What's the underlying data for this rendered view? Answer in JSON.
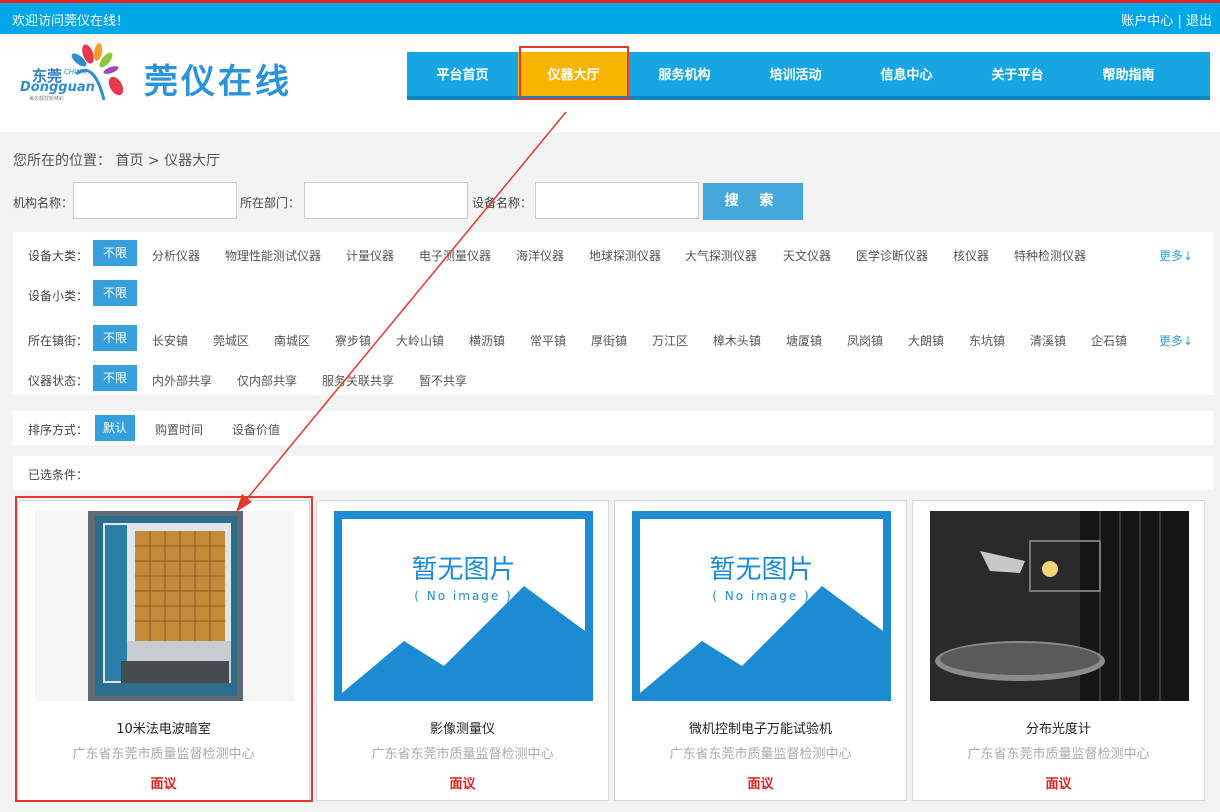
{
  "topbar": {
    "welcome": "欢迎访问莞仪在线！",
    "account": "账户中心",
    "separator": "|",
    "logout": "退出"
  },
  "logo": {
    "city_cn": "东莞",
    "city_en": "Dongguan",
    "china": "CHINA",
    "slogan": "每天都放新精彩",
    "site_name": "莞仪在线"
  },
  "nav": {
    "items": [
      "平台首页",
      "仪器大厅",
      "服务机构",
      "培训活动",
      "信息中心",
      "关于平台",
      "帮助指南"
    ],
    "active_index": 1
  },
  "breadcrumb": {
    "prefix": "您所在的位置：",
    "home": "首页",
    "sep": ">",
    "current": "仪器大厅"
  },
  "search": {
    "org_label": "机构名称：",
    "dept_label": "所在部门：",
    "device_label": "设备名称：",
    "org_value": "",
    "dept_value": "",
    "device_value": "",
    "button": "搜 索"
  },
  "filters": {
    "category": {
      "label": "设备大类：",
      "selected": "不限",
      "options": [
        "分析仪器",
        "物理性能测试仪器",
        "计量仪器",
        "电子测量仪器",
        "海洋仪器",
        "地球探测仪器",
        "大气探测仪器",
        "天文仪器",
        "医学诊断仪器",
        "核仪器",
        "特种检测仪器"
      ],
      "more": "更多↓"
    },
    "subcategory": {
      "label": "设备小类：",
      "selected": "不限"
    },
    "town": {
      "label": "所在镇街：",
      "selected": "不限",
      "options": [
        "长安镇",
        "莞城区",
        "南城区",
        "寮步镇",
        "大岭山镇",
        "横沥镇",
        "常平镇",
        "厚街镇",
        "万江区",
        "樟木头镇",
        "塘厦镇",
        "凤岗镇",
        "大朗镇",
        "东坑镇",
        "清溪镇",
        "企石镇"
      ],
      "more": "更多↓"
    },
    "status": {
      "label": "仪器状态：",
      "selected": "不限",
      "options": [
        "内外部共享",
        "仅内部共享",
        "服务关联共享",
        "暂不共享"
      ]
    }
  },
  "sort": {
    "label": "排序方式：",
    "selected": "默认",
    "options": [
      "购置时间",
      "设备价值"
    ]
  },
  "selected_conditions": {
    "label": "已选条件："
  },
  "no_image": {
    "text": "暂无图片",
    "sub": "( No image )"
  },
  "cards": [
    {
      "title": "10米法电波暗室",
      "org": "广东省东莞市质量监督检测中心",
      "price": "面议",
      "image": "anechoic-chamber"
    },
    {
      "title": "影像测量仪",
      "org": "广东省东莞市质量监督检测中心",
      "price": "面议",
      "image": "no-image"
    },
    {
      "title": "微机控制电子万能试验机",
      "org": "广东省东莞市质量监督检测中心",
      "price": "面议",
      "image": "no-image"
    },
    {
      "title": "分布光度计",
      "org": "广东省东莞市质量监督检测中心",
      "price": "面议",
      "image": "goniophotometer"
    }
  ],
  "colors": {
    "topbar": "#00a7e8",
    "nav": "#18a6e2",
    "nav_active": "#f7b500",
    "accent": "#35a0dc",
    "highlight": "#e23a2f",
    "price": "#e02020"
  }
}
